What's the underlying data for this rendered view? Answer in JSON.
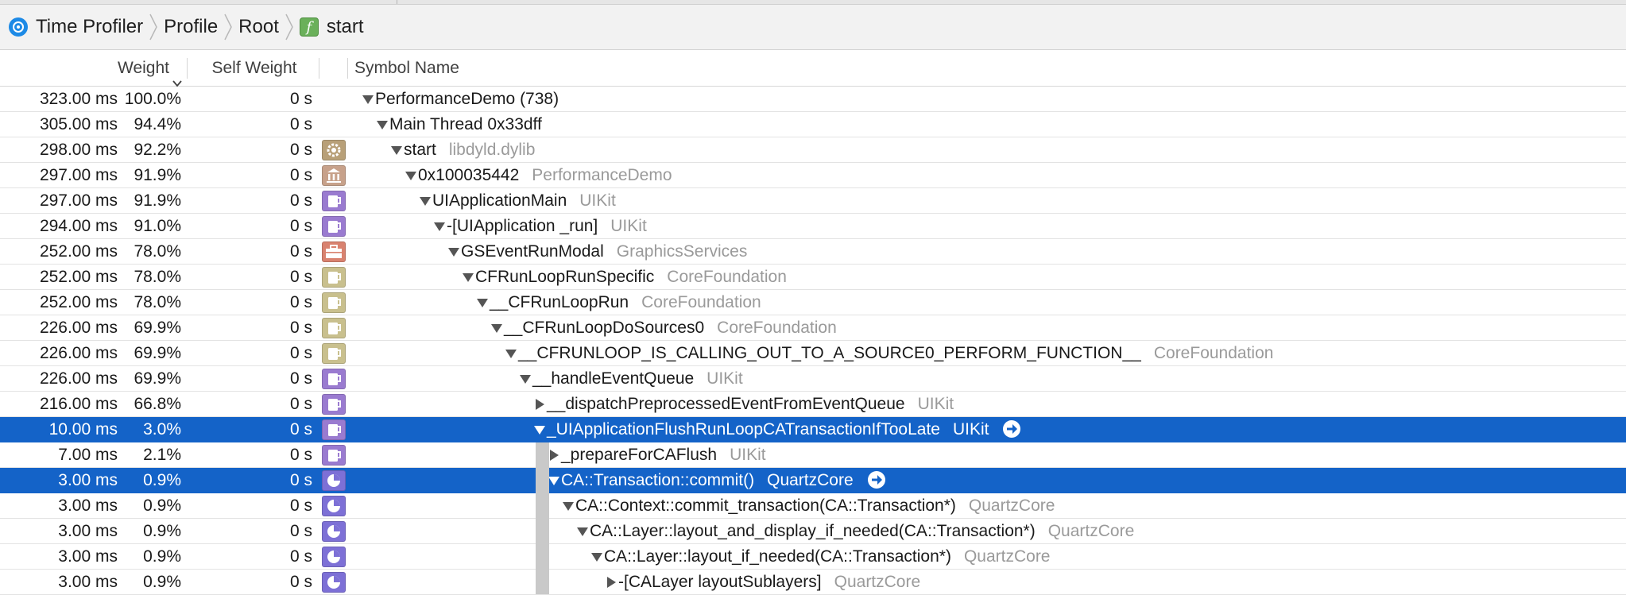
{
  "breadcrumb": {
    "items": [
      {
        "label": "Time Profiler",
        "icon": "time-profiler-icon"
      },
      {
        "label": "Profile"
      },
      {
        "label": "Root"
      },
      {
        "label": "start",
        "icon": "function-icon",
        "icon_glyph": "f"
      }
    ]
  },
  "columns": {
    "weight": "Weight",
    "self_weight": "Self Weight",
    "symbol_name": "Symbol Name"
  },
  "colors": {
    "selection": "#1463c8",
    "library_text": "#9a9a9a",
    "icon_uikit": "#9a7bd0",
    "icon_corefoundation": "#c9c08e",
    "icon_quartzcore": "#7d70d6",
    "icon_libdyld": "#b8a078",
    "icon_app": "#c7a18a",
    "icon_graphics": "#d9826f"
  },
  "rows": [
    {
      "ms": "323.00 ms",
      "pct": "100.0%",
      "self": "0 s",
      "indent": 0,
      "disc": "open",
      "symbol": "PerformanceDemo (738)",
      "library": "",
      "icon": "none",
      "selected": false
    },
    {
      "ms": "305.00 ms",
      "pct": "94.4%",
      "self": "0 s",
      "indent": 1,
      "disc": "open",
      "symbol": "Main Thread  0x33dff",
      "library": "",
      "icon": "none",
      "selected": false
    },
    {
      "ms": "298.00 ms",
      "pct": "92.2%",
      "self": "0 s",
      "indent": 2,
      "disc": "open",
      "symbol": "start",
      "library": "libdyld.dylib",
      "icon": "gear-icon",
      "selected": false
    },
    {
      "ms": "297.00 ms",
      "pct": "91.9%",
      "self": "0 s",
      "indent": 3,
      "disc": "open",
      "symbol": "0x100035442",
      "library": "PerformanceDemo",
      "icon": "building-icon",
      "selected": false
    },
    {
      "ms": "297.00 ms",
      "pct": "91.9%",
      "self": "0 s",
      "indent": 4,
      "disc": "open",
      "symbol": "UIApplicationMain",
      "library": "UIKit",
      "icon": "mug-icon",
      "selected": false
    },
    {
      "ms": "294.00 ms",
      "pct": "91.0%",
      "self": "0 s",
      "indent": 5,
      "disc": "open",
      "symbol": "-[UIApplication _run]",
      "library": "UIKit",
      "icon": "mug-icon",
      "selected": false
    },
    {
      "ms": "252.00 ms",
      "pct": "78.0%",
      "self": "0 s",
      "indent": 6,
      "disc": "open",
      "symbol": "GSEventRunModal",
      "library": "GraphicsServices",
      "icon": "toolbox-icon",
      "selected": false
    },
    {
      "ms": "252.00 ms",
      "pct": "78.0%",
      "self": "0 s",
      "indent": 7,
      "disc": "open",
      "symbol": "CFRunLoopRunSpecific",
      "library": "CoreFoundation",
      "icon": "cup-icon",
      "selected": false
    },
    {
      "ms": "252.00 ms",
      "pct": "78.0%",
      "self": "0 s",
      "indent": 8,
      "disc": "open",
      "symbol": "__CFRunLoopRun",
      "library": "CoreFoundation",
      "icon": "cup-icon",
      "selected": false
    },
    {
      "ms": "226.00 ms",
      "pct": "69.9%",
      "self": "0 s",
      "indent": 9,
      "disc": "open",
      "symbol": "__CFRunLoopDoSources0",
      "library": "CoreFoundation",
      "icon": "cup-icon",
      "selected": false
    },
    {
      "ms": "226.00 ms",
      "pct": "69.9%",
      "self": "0 s",
      "indent": 10,
      "disc": "open",
      "symbol": "__CFRUNLOOP_IS_CALLING_OUT_TO_A_SOURCE0_PERFORM_FUNCTION__",
      "library": "CoreFoundation",
      "icon": "cup-icon",
      "selected": false
    },
    {
      "ms": "226.00 ms",
      "pct": "69.9%",
      "self": "0 s",
      "indent": 11,
      "disc": "open",
      "symbol": "__handleEventQueue",
      "library": "UIKit",
      "icon": "mug-icon",
      "selected": false
    },
    {
      "ms": "216.00 ms",
      "pct": "66.8%",
      "self": "0 s",
      "indent": 12,
      "disc": "closed",
      "symbol": "__dispatchPreprocessedEventFromEventQueue",
      "library": "UIKit",
      "icon": "mug-icon",
      "selected": false
    },
    {
      "ms": "10.00 ms",
      "pct": "3.0%",
      "self": "0 s",
      "indent": 12,
      "disc": "open",
      "symbol": "_UIApplicationFlushRunLoopCATransactionIfTooLate",
      "library": "UIKit",
      "icon": "mug-icon",
      "selected": true
    },
    {
      "ms": "7.00 ms",
      "pct": "2.1%",
      "self": "0 s",
      "indent": 13,
      "disc": "closed",
      "symbol": "_prepareForCAFlush",
      "library": "UIKit",
      "icon": "mug-icon",
      "selected": false
    },
    {
      "ms": "3.00 ms",
      "pct": "0.9%",
      "self": "0 s",
      "indent": 13,
      "disc": "open",
      "symbol": "CA::Transaction::commit()",
      "library": "QuartzCore",
      "icon": "pie-icon",
      "selected": true
    },
    {
      "ms": "3.00 ms",
      "pct": "0.9%",
      "self": "0 s",
      "indent": 14,
      "disc": "open",
      "symbol": "CA::Context::commit_transaction(CA::Transaction*)",
      "library": "QuartzCore",
      "icon": "pie-icon",
      "selected": false
    },
    {
      "ms": "3.00 ms",
      "pct": "0.9%",
      "self": "0 s",
      "indent": 15,
      "disc": "open",
      "symbol": "CA::Layer::layout_and_display_if_needed(CA::Transaction*)",
      "library": "QuartzCore",
      "icon": "pie-icon",
      "selected": false
    },
    {
      "ms": "3.00 ms",
      "pct": "0.9%",
      "self": "0 s",
      "indent": 16,
      "disc": "open",
      "symbol": "CA::Layer::layout_if_needed(CA::Transaction*)",
      "library": "QuartzCore",
      "icon": "pie-icon",
      "selected": false
    },
    {
      "ms": "3.00 ms",
      "pct": "0.9%",
      "self": "0 s",
      "indent": 17,
      "disc": "closed",
      "symbol": "-[CALayer layoutSublayers]",
      "library": "QuartzCore",
      "icon": "pie-icon",
      "selected": false
    }
  ]
}
